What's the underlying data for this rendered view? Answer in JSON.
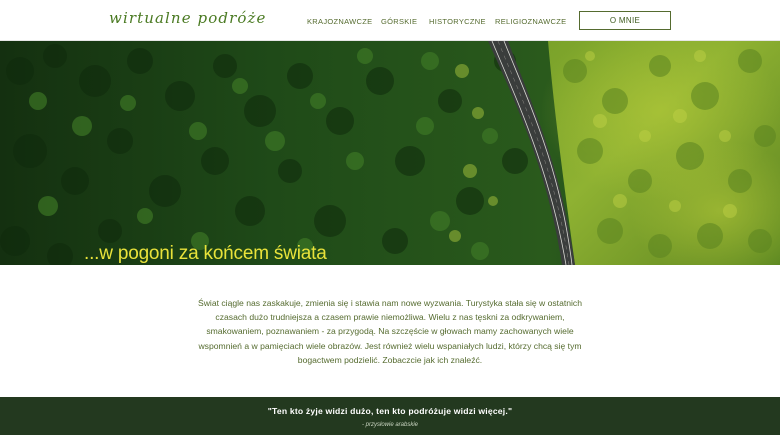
{
  "header": {
    "logo": "wirtualne podróże",
    "nav": [
      {
        "label": "KRAJOZNAWCZE"
      },
      {
        "label": "GÓRSKIE"
      },
      {
        "label": "HISTORYCZNE"
      },
      {
        "label": "RELIGIOZNAWCZE"
      }
    ],
    "about_label": "O MNIE"
  },
  "hero": {
    "title": "...w pogoni za końcem świata",
    "title_color": "#e8e23a"
  },
  "intro": {
    "text": "Świat ciągle nas zaskakuje, zmienia się i stawia nam nowe wyzwania. Turystyka stała się w ostatnich czasach dużo trudniejsza a czasem prawie niemożliwa. Wielu z nas tęskni za odkrywaniem, smakowaniem, poznawaniem - za przygodą. Na szczęście w głowach mamy zachowanych wiele wspomnień a w pamięciach wiele obrazów. Jest również wielu wspaniałych ludzi, którzy chcą się tym bogactwem podzielić. Zobaczcie jak ich znaleźć."
  },
  "footer": {
    "quote": "\"Ten kto żyje widzi dużo, ten kto podróżuje widzi więcej.\"",
    "source": "- przysłowie arabskie"
  },
  "colors": {
    "brand_green": "#4a7a22",
    "text_green": "#556b2f",
    "footer_bg": "#23391f"
  }
}
